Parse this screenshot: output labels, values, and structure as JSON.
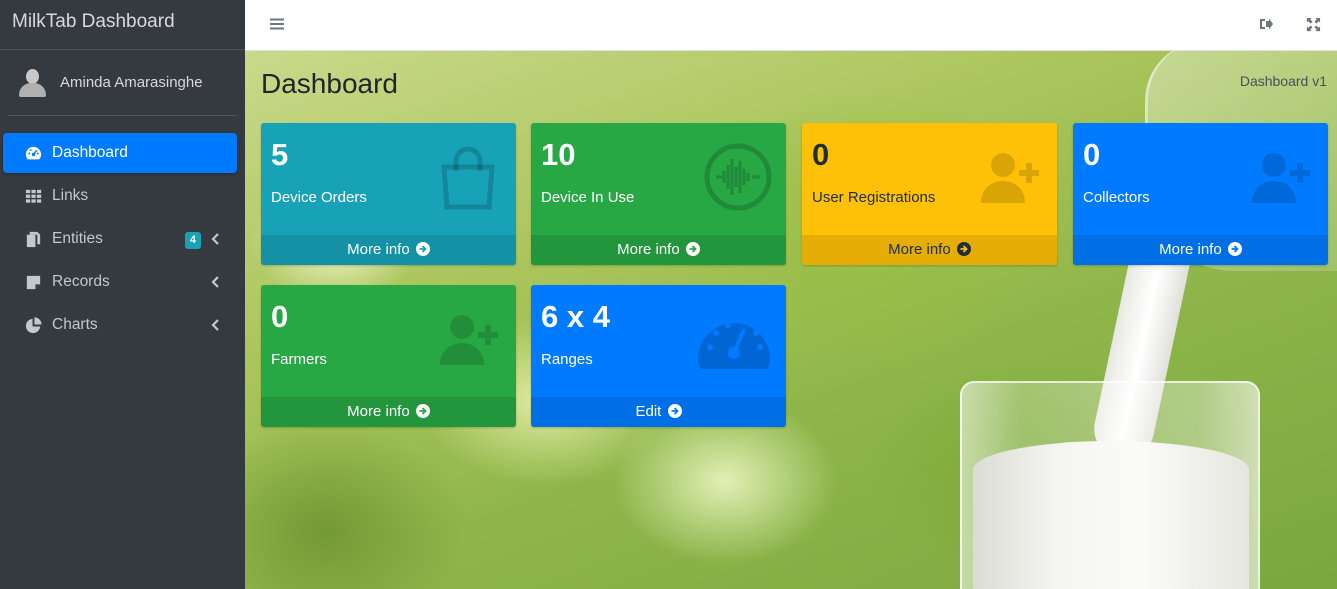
{
  "brand": "MilkTab Dashboard",
  "user": {
    "name": "Aminda Amarasinghe"
  },
  "nav": [
    {
      "label": "Dashboard",
      "icon": "tachometer-icon",
      "active": true
    },
    {
      "label": "Links",
      "icon": "grid-icon"
    },
    {
      "label": "Entities",
      "icon": "copy-icon",
      "badge": "4"
    },
    {
      "label": "Records",
      "icon": "sticky-note-icon"
    },
    {
      "label": "Charts",
      "icon": "pie-chart-icon"
    }
  ],
  "page": {
    "title": "Dashboard",
    "breadcrumb": "Dashboard v1"
  },
  "cards": [
    {
      "value": "5",
      "label": "Device Orders",
      "footer": "More info",
      "icon": "shopping-bag-icon",
      "color": "#17a2b8"
    },
    {
      "value": "10",
      "label": "Device In Use",
      "footer": "More info",
      "icon": "waveform-icon",
      "color": "#28a745"
    },
    {
      "value": "0",
      "label": "User Registrations",
      "footer": "More info",
      "icon": "user-plus-icon",
      "color": "#ffc107"
    },
    {
      "value": "0",
      "label": "Collectors",
      "footer": "More info",
      "icon": "user-plus-icon",
      "color": "#007bff"
    },
    {
      "value": "0",
      "label": "Farmers",
      "footer": "More info",
      "icon": "user-plus-icon",
      "color": "#28a745"
    },
    {
      "value": "6 x 4",
      "label": "Ranges",
      "footer": "Edit",
      "icon": "gauge-icon",
      "color": "#007bff"
    }
  ]
}
